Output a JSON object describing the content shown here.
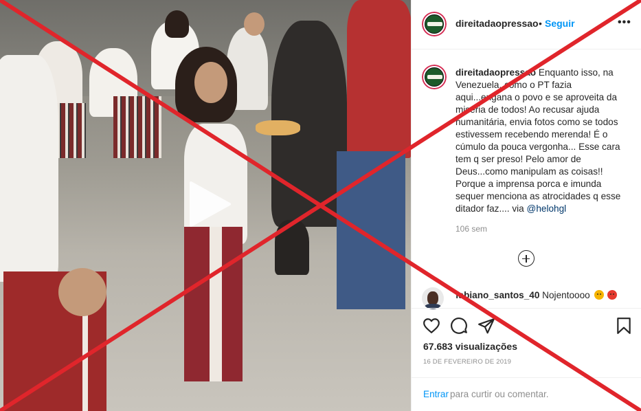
{
  "post": {
    "username": "direitadaopressao",
    "separator": "•",
    "follow_label": "Seguir",
    "more_label": "•••"
  },
  "caption": {
    "username": "direitadaopressao",
    "text": "Enquanto isso, na Venezuela, como o PT fazia aqui...engana o povo e se aproveita da miséria de todos! Ao recusar ajuda humanitária, envia fotos como se todos estivessem recebendo merenda! É o cúmulo da pouca vergonha... Esse cara tem q ser preso! Pelo amor de Deus...como manipulam as coisas!! Porque a imprensa porca e imunda sequer menciona as atrocidades q esse ditador faz.... via",
    "mention": "@helohgl",
    "time_ago": "106 sem"
  },
  "comments": [
    {
      "username": "fabiano_santos_40",
      "text": "Nojentoooo",
      "emojis": [
        "angry-face",
        "pouting-face"
      ]
    }
  ],
  "stats": {
    "views": "67.683 visualizações",
    "date": "16 DE FEVEREIRO DE 2019"
  },
  "login": {
    "link_label": "Entrar",
    "text": "para curtir ou comentar."
  },
  "icons": {
    "play": "play-icon",
    "like": "heart-icon",
    "comment": "comment-icon",
    "share": "paper-plane-icon",
    "save": "bookmark-icon",
    "load_more": "plus-circle-icon",
    "more": "more-icon"
  },
  "colors": {
    "link_blue": "#0095f6",
    "mention_blue": "#00376b",
    "muted_gray": "#8e8e8e",
    "cross_red": "#e0252b",
    "text": "#262626"
  }
}
